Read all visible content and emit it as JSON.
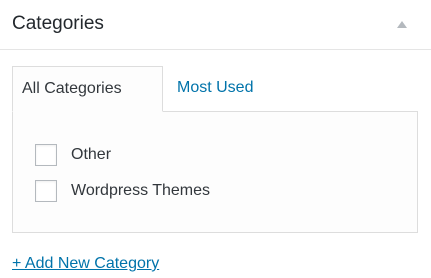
{
  "panel": {
    "title": "Categories"
  },
  "tabs": [
    {
      "label": "All Categories",
      "active": true
    },
    {
      "label": "Most Used",
      "active": false
    }
  ],
  "categories": [
    {
      "label": "Other",
      "checked": false
    },
    {
      "label": "Wordpress Themes",
      "checked": false
    }
  ],
  "add_link": {
    "label": "+ Add New Category"
  },
  "colors": {
    "link": "#0073aa",
    "text": "#32373c",
    "border": "#dddddd"
  }
}
